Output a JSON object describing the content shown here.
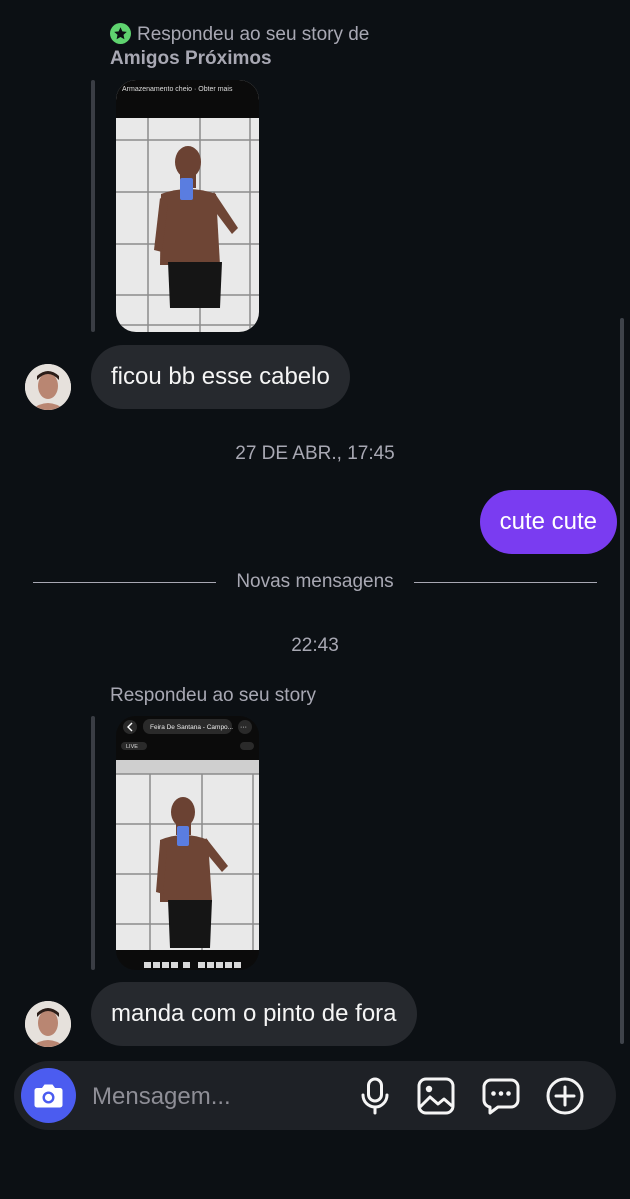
{
  "first_story_reply": {
    "header_text": "Respondeu ao seu story de",
    "header_bold": "Amigos Próximos",
    "thumbnail_status_text": "Armazenamento cheio · Obter mais",
    "reply_message": "ficou bb esse cabelo"
  },
  "timestamp_1": "27 DE ABR., 17:45",
  "outgoing_message": "cute cute",
  "new_messages_divider": "Novas mensagens",
  "timestamp_2": "22:43",
  "second_story_reply": {
    "header_text": "Respondeu ao seu story",
    "thumbnail_location": "Feira De Santana - Campo...",
    "thumbnail_live_badge": "LIVE",
    "reply_message": "manda com o pinto de fora"
  },
  "composer": {
    "placeholder": "Mensagem...",
    "icons": [
      "camera-icon",
      "microphone-icon",
      "gallery-icon",
      "sticker-chat-icon",
      "plus-icon"
    ]
  },
  "colors": {
    "background": "#0c1014",
    "incoming_bubble": "#26292e",
    "outgoing_bubble": "#7a3cf1",
    "camera_button": "#4b5cf0",
    "close_friends_star": "#5fd36f"
  }
}
